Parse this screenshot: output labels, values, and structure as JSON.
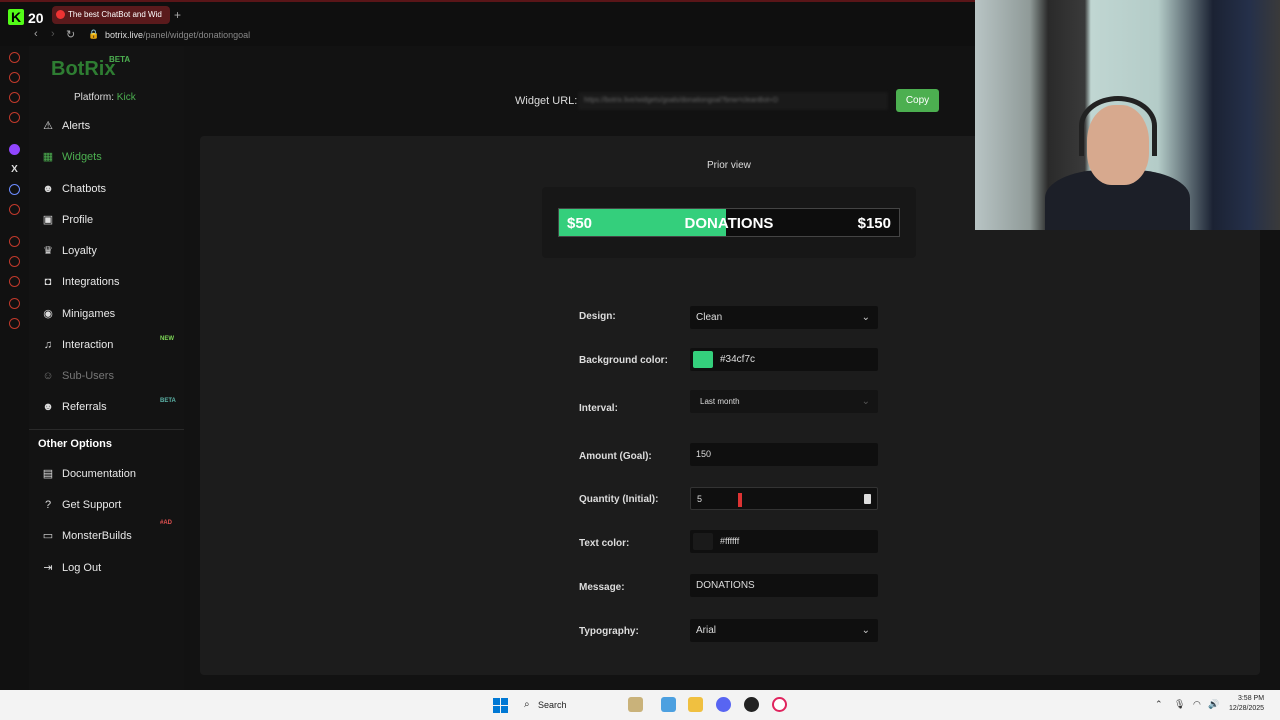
{
  "browser": {
    "kick_count": "20",
    "tab_title": "The best ChatBot and Wid",
    "new_tab": "+",
    "url_host": "botrix.live",
    "url_path": "/panel/widget/donationgoal"
  },
  "sidebar": {
    "brand": "BotRix",
    "brand_badge": "BETA",
    "platform_label": "Platform:",
    "platform_value": "Kick",
    "items": [
      {
        "label": "Alerts",
        "icon": "warning-icon",
        "glyph": "⚠",
        "state": "normal"
      },
      {
        "label": "Widgets",
        "icon": "grid-icon",
        "glyph": "▦",
        "state": "active"
      },
      {
        "label": "Chatbots",
        "icon": "robot-icon",
        "glyph": "☻",
        "state": "normal"
      },
      {
        "label": "Profile",
        "icon": "id-card-icon",
        "glyph": "▣",
        "state": "normal"
      },
      {
        "label": "Loyalty",
        "icon": "trophy-icon",
        "glyph": "♛",
        "state": "normal"
      },
      {
        "label": "Integrations",
        "icon": "puzzle-icon",
        "glyph": "◘",
        "state": "normal"
      },
      {
        "label": "Minigames",
        "icon": "gamepad-icon",
        "glyph": "◉",
        "state": "normal"
      },
      {
        "label": "Interaction",
        "icon": "music-icon",
        "glyph": "♫",
        "state": "normal",
        "tag": "NEW"
      },
      {
        "label": "Sub-Users",
        "icon": "users-icon",
        "glyph": "☺",
        "state": "dim"
      },
      {
        "label": "Referrals",
        "icon": "people-icon",
        "glyph": "☻",
        "state": "normal",
        "tag": "BETA"
      }
    ],
    "other_options_title": "Other Options",
    "other_items": [
      {
        "label": "Documentation",
        "icon": "book-icon",
        "glyph": "▤"
      },
      {
        "label": "Get Support",
        "icon": "help-icon",
        "glyph": "?"
      },
      {
        "label": "MonsterBuilds",
        "icon": "laptop-icon",
        "glyph": "▭",
        "tag": "#AD"
      },
      {
        "label": "Log Out",
        "icon": "logout-icon",
        "glyph": "⇥"
      }
    ]
  },
  "header": {
    "widget_url_label": "Widget URL:",
    "widget_url_value": "https://botrix.live/widgets/goals/donationgoal?bnw=cleanBot+D",
    "copy_label": "Copy"
  },
  "preview": {
    "title": "Prior view",
    "start_amount": "$50",
    "message": "DONATIONS",
    "goal_amount": "$150",
    "progress_fraction": 0.49,
    "bar_color": "#34cf7c"
  },
  "form": {
    "design_label": "Design:",
    "design_value": "Clean",
    "bg_color_label": "Background color:",
    "bg_color_value": "#34cf7c",
    "interval_label": "Interval:",
    "interval_value": "Last month",
    "amount_label": "Amount (Goal):",
    "amount_value": "150",
    "quantity_label": "Quantity (Initial):",
    "quantity_value": "5",
    "text_color_label": "Text color:",
    "text_color_value": "#ffffff",
    "message_label": "Message:",
    "message_value": "DONATIONS",
    "typography_label": "Typography:",
    "typography_value": "Arial"
  },
  "taskbar": {
    "search_label": "Search",
    "time": "3:58 PM",
    "date": "12/28/2025"
  },
  "colors": {
    "accent": "#4caf50",
    "kick_green": "#53fc18",
    "text_swatch": "#1a1a1a"
  }
}
